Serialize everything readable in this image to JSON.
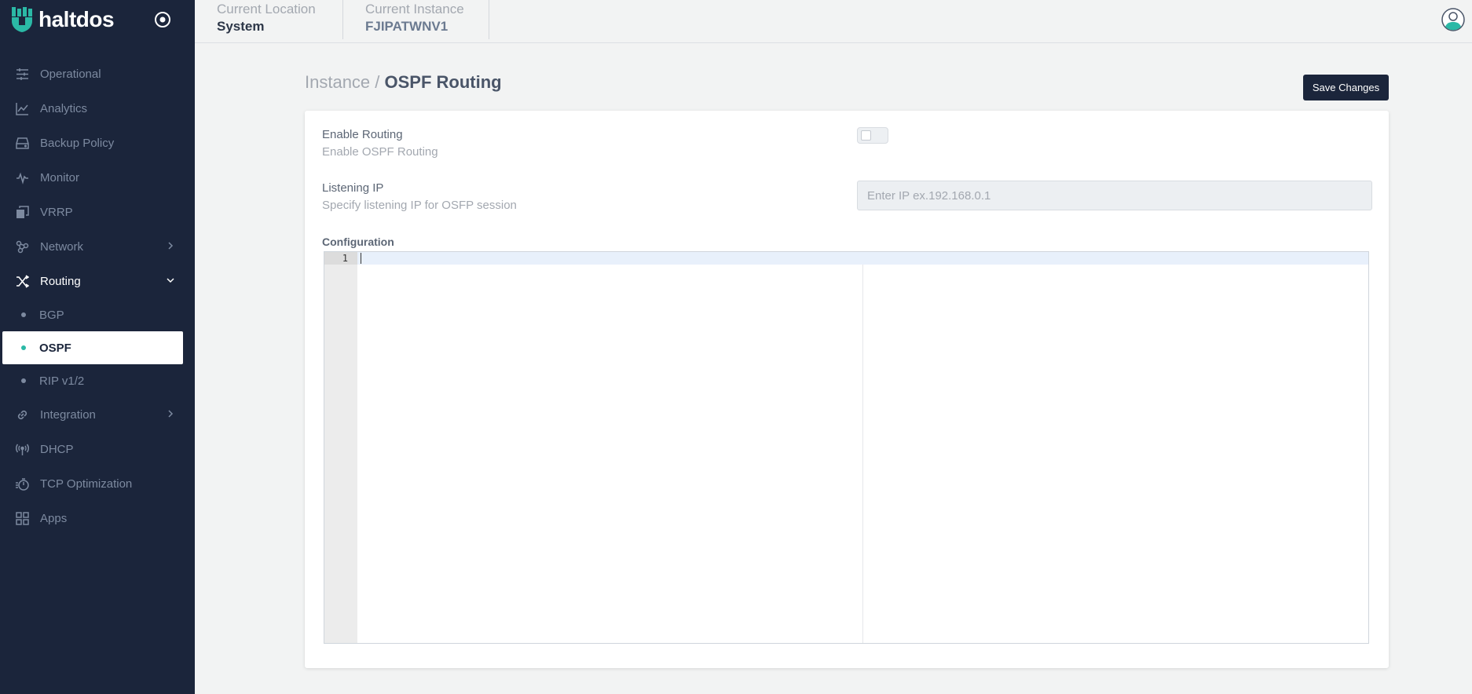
{
  "brand": {
    "name": "haltdos"
  },
  "sidebar": {
    "items": [
      {
        "label": "Operational",
        "icon": "sliders-icon"
      },
      {
        "label": "Analytics",
        "icon": "line-chart-icon"
      },
      {
        "label": "Backup Policy",
        "icon": "hard-drive-icon"
      },
      {
        "label": "Monitor",
        "icon": "pulse-icon"
      },
      {
        "label": "VRRP",
        "icon": "copy-icon"
      },
      {
        "label": "Network",
        "icon": "network-nodes-icon"
      },
      {
        "label": "Routing",
        "icon": "shuffle-icon"
      },
      {
        "label": "Integration",
        "icon": "link-icon"
      },
      {
        "label": "DHCP",
        "icon": "broadcast-icon"
      },
      {
        "label": "TCP Optimization",
        "icon": "timer-icon"
      },
      {
        "label": "Apps",
        "icon": "grid-icon"
      }
    ],
    "routing_subitems": [
      {
        "label": "BGP"
      },
      {
        "label": "OSPF"
      },
      {
        "label": "RIP v1/2"
      }
    ],
    "selected": "OSPF"
  },
  "header": {
    "location_label": "Current Location",
    "location_value": "System",
    "instance_label": "Current Instance",
    "instance_value": "FJIPATWNV1"
  },
  "page": {
    "breadcrumb_parent": "Instance /",
    "title": "OSPF Routing",
    "save_label": "Save Changes"
  },
  "form": {
    "enable_label": "Enable Routing",
    "enable_desc": "Enable OSPF Routing",
    "enable_value": false,
    "ip_label": "Listening IP",
    "ip_desc": "Specify listening IP for OSFP session",
    "ip_placeholder": "Enter IP ex.192.168.0.1",
    "ip_value": "",
    "config_label": "Configuration",
    "config_line_number": "1",
    "config_value": ""
  },
  "colors": {
    "sidebar_bg": "#1b253b",
    "accent": "#2bb9a6",
    "save_button_bg": "#1b253b"
  }
}
